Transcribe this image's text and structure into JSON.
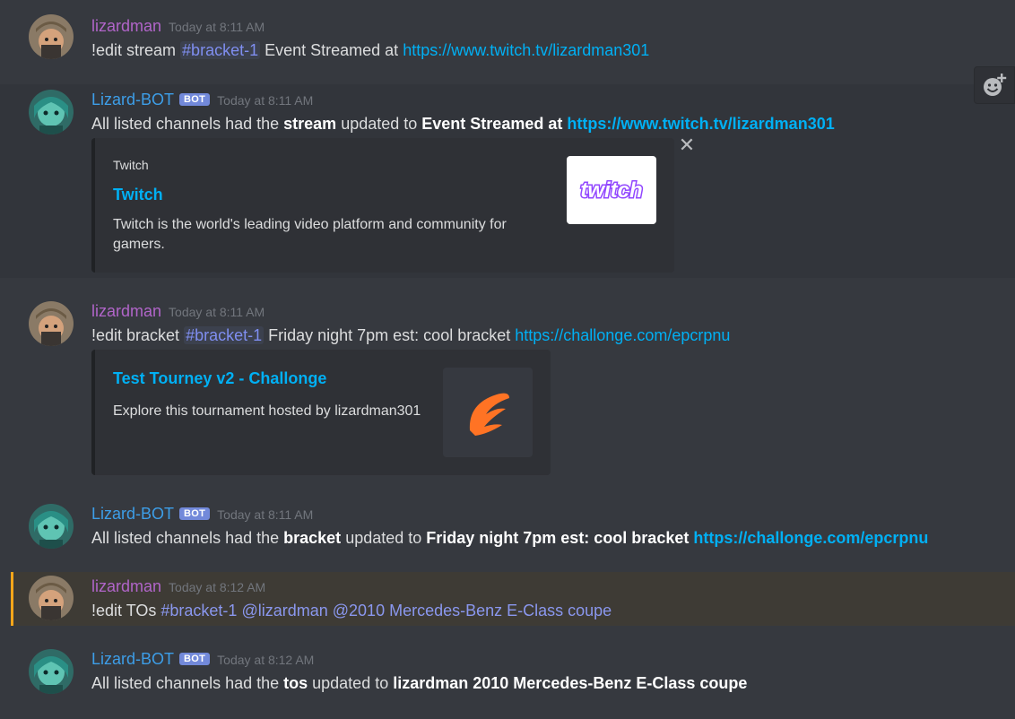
{
  "messages": [
    {
      "author": "lizardman",
      "timestamp": "Today at 8:11 AM",
      "parts": [
        "!edit stream ",
        "#bracket-1",
        " Event Streamed at ",
        "https://www.twitch.tv/lizardman301"
      ]
    },
    {
      "author": "Lizard-BOT",
      "badge": "BOT",
      "timestamp": "Today at 8:11 AM",
      "parts": [
        "All listed channels had the ",
        "stream",
        " updated to ",
        "Event Streamed at ",
        "https://www.twitch.tv/lizardman301"
      ],
      "embed": {
        "provider": "Twitch",
        "title": "Twitch",
        "description_line1": "Twitch is the world's leading video platform and community for",
        "description_line2": "gamers.",
        "thumb_text": "twitch",
        "thumb_color": "#9146ff"
      }
    },
    {
      "author": "lizardman",
      "timestamp": "Today at 8:11 AM",
      "parts": [
        "!edit bracket ",
        "#bracket-1",
        " Friday night 7pm est: cool bracket ",
        "https://challonge.com/epcrpnu"
      ],
      "embed": {
        "title": "Test Tourney v2 - Challonge",
        "description": "Explore this tournament hosted by lizardman301",
        "thumb_color": "#ff7324"
      }
    },
    {
      "author": "Lizard-BOT",
      "badge": "BOT",
      "timestamp": "Today at 8:11 AM",
      "parts": [
        "All listed channels had the ",
        "bracket",
        " updated to ",
        "Friday night 7pm est: cool bracket ",
        "https://challonge.com/epcrpnu"
      ]
    },
    {
      "author": "lizardman",
      "timestamp": "Today at 8:12 AM",
      "parts": [
        "!edit TOs ",
        "#bracket-1",
        " ",
        "@lizardman",
        " ",
        "@2010 Mercedes-Benz E-Class coupe"
      ]
    },
    {
      "author": "Lizard-BOT",
      "badge": "BOT",
      "timestamp": "Today at 8:12 AM",
      "parts": [
        "All listed channels had the ",
        "tos",
        " updated to ",
        "lizardman 2010 Mercedes-Benz E-Class coupe"
      ]
    }
  ],
  "colors": {
    "background": "#36393f",
    "user_name": "#b165c9",
    "bot_name": "#3d9ee8",
    "link": "#00b0f4",
    "mention_highlight": "#faa61a"
  },
  "icons": {
    "add_reaction": "add-reaction-icon",
    "close_embed": "close-icon"
  }
}
